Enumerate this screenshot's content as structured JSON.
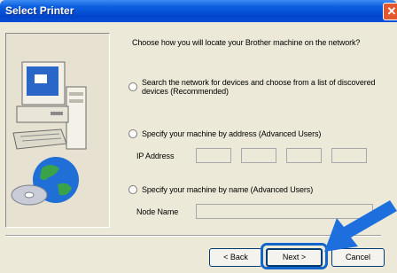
{
  "window": {
    "title": "Select Printer",
    "close_icon": "close-x-icon"
  },
  "instruction": "Choose how you will locate your Brother machine on the network?",
  "options": [
    {
      "line1": "Search the network for devices and choose from a list of discovered",
      "line2": "devices (Recommended)"
    },
    {
      "line1": "Specify your machine by address (Advanced Users)",
      "field_label": "IP Address"
    },
    {
      "line1": "Specify your machine by name (Advanced Users)",
      "field_label": "Node Name"
    }
  ],
  "buttons": {
    "back": "< Back",
    "next": "Next >",
    "cancel": "Cancel"
  },
  "illustration": "computer-with-globe-and-cd-illustration",
  "colors": {
    "titlebar": "#0a5fe0",
    "highlight": "#1366c9",
    "arrow": "#1c6fdc"
  }
}
